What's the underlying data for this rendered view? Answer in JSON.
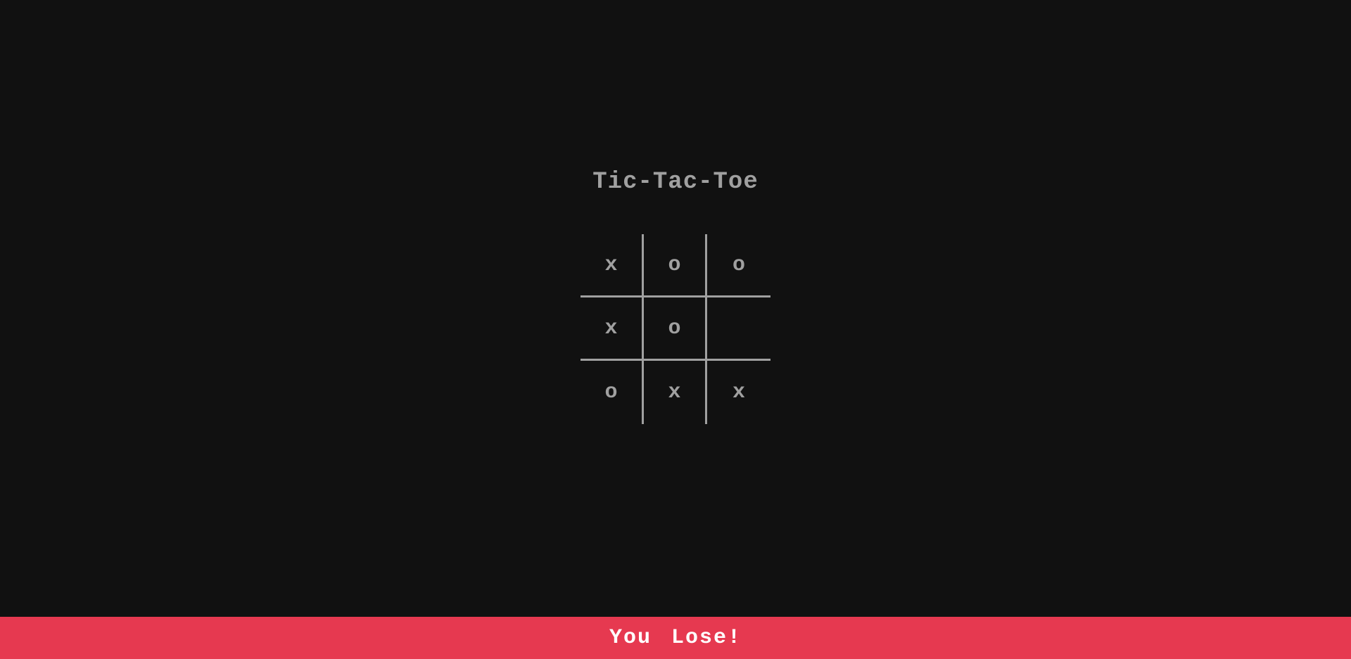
{
  "title": "Tic-Tac-Toe",
  "board": {
    "cells": [
      "x",
      "o",
      "o",
      "x",
      "o",
      "",
      "o",
      "x",
      "x"
    ]
  },
  "status": {
    "message": "You Lose!",
    "color": "#e63950"
  }
}
